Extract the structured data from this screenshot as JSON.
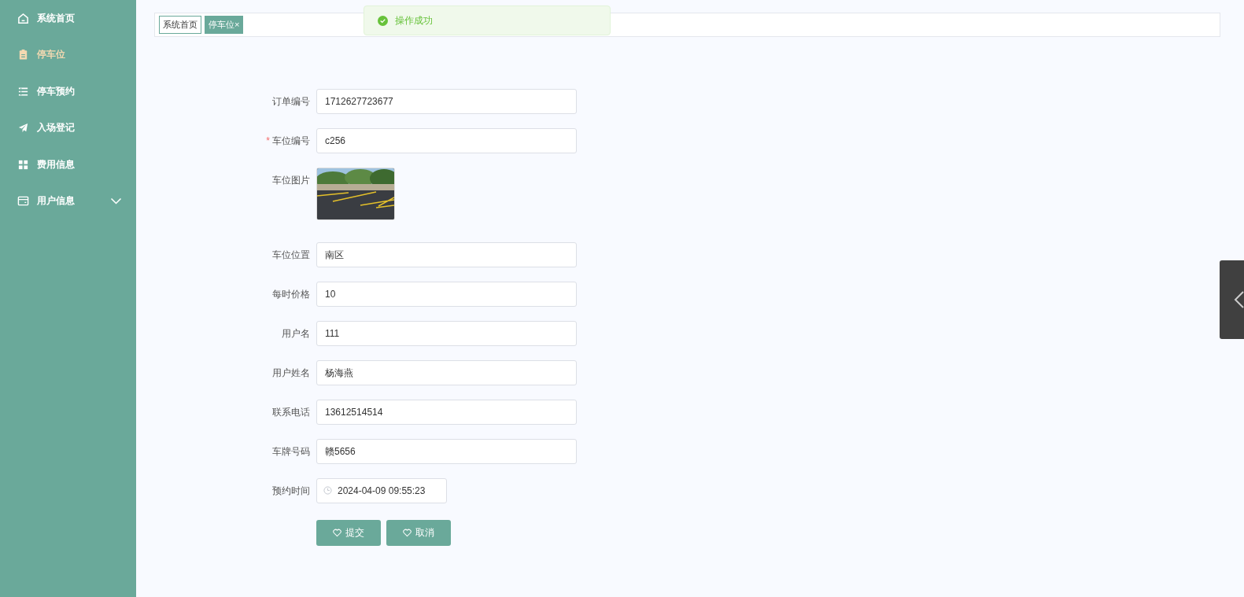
{
  "sidebar": {
    "items": [
      {
        "label": "系统首页",
        "selected": false
      },
      {
        "label": "停车位",
        "selected": true
      },
      {
        "label": "停车预约",
        "selected": false
      },
      {
        "label": "入场登记",
        "selected": false
      },
      {
        "label": "费用信息",
        "selected": false
      },
      {
        "label": "用户信息",
        "selected": false,
        "expanded": false
      }
    ]
  },
  "tabs": [
    {
      "label": "系统首页",
      "selected": false
    },
    {
      "label": "停车位×",
      "selected": true
    }
  ],
  "toast": {
    "message": "操作成功"
  },
  "form": {
    "fields": [
      {
        "kind": "text",
        "label": "订单编号",
        "value": "1712627723677"
      },
      {
        "kind": "text",
        "label": "车位编号",
        "value": "c256",
        "required_mark": "*"
      },
      {
        "label": "车位图片"
      },
      {
        "kind": "text",
        "label": "车位位置",
        "value": "南区"
      },
      {
        "kind": "text",
        "label": "每时价格",
        "value": "10"
      },
      {
        "kind": "text",
        "label": "用户名",
        "value": "111"
      },
      {
        "kind": "text",
        "label": "用户姓名",
        "value": "杨海燕"
      },
      {
        "kind": "text",
        "label": "联系电话",
        "value": "13612514514"
      },
      {
        "kind": "text",
        "label": "车牌号码",
        "value": "赣5656"
      },
      {
        "kind": "date",
        "label": "预约时间",
        "value": "2024-04-09 09:55:23"
      }
    ],
    "buttons": [
      "提交",
      "取消"
    ]
  }
}
